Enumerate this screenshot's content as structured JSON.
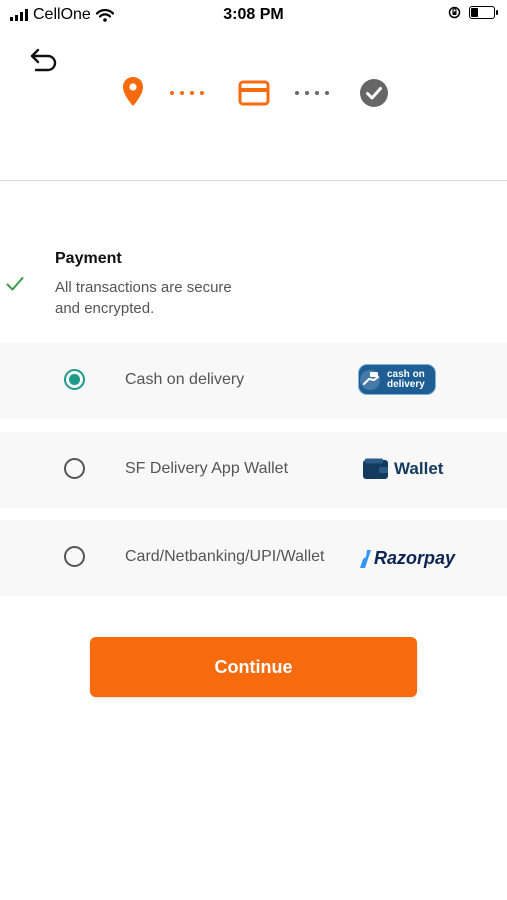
{
  "status_bar": {
    "carrier": "CellOne",
    "time": "3:08 PM",
    "battery_level": 0.3
  },
  "header": {
    "back_icon": "undo-arrow-icon"
  },
  "stepper": {
    "steps": [
      {
        "icon": "location-pin-icon",
        "state": "done"
      },
      {
        "icon": "credit-card-icon",
        "state": "active"
      },
      {
        "icon": "check-circle-icon",
        "state": "pending"
      }
    ],
    "colors": {
      "active": "#f86a0e",
      "pending": "#666666"
    }
  },
  "payment": {
    "title": "Payment",
    "subtitle": "All transactions are secure\n and encrypted."
  },
  "options": [
    {
      "label": "Cash on delivery",
      "selected": true,
      "logo_text": "cash on\ndelivery"
    },
    {
      "label": "SF Delivery App Wallet",
      "selected": false,
      "logo_text": "Wallet"
    },
    {
      "label": "Card/Netbanking/UPI/Wallet",
      "selected": false,
      "logo_text": "Razorpay"
    }
  ],
  "continue_label": "Continue",
  "colors": {
    "accent": "#f86a0e",
    "radio_selected": "#1d9a8a",
    "check": "#3b9a4a"
  }
}
